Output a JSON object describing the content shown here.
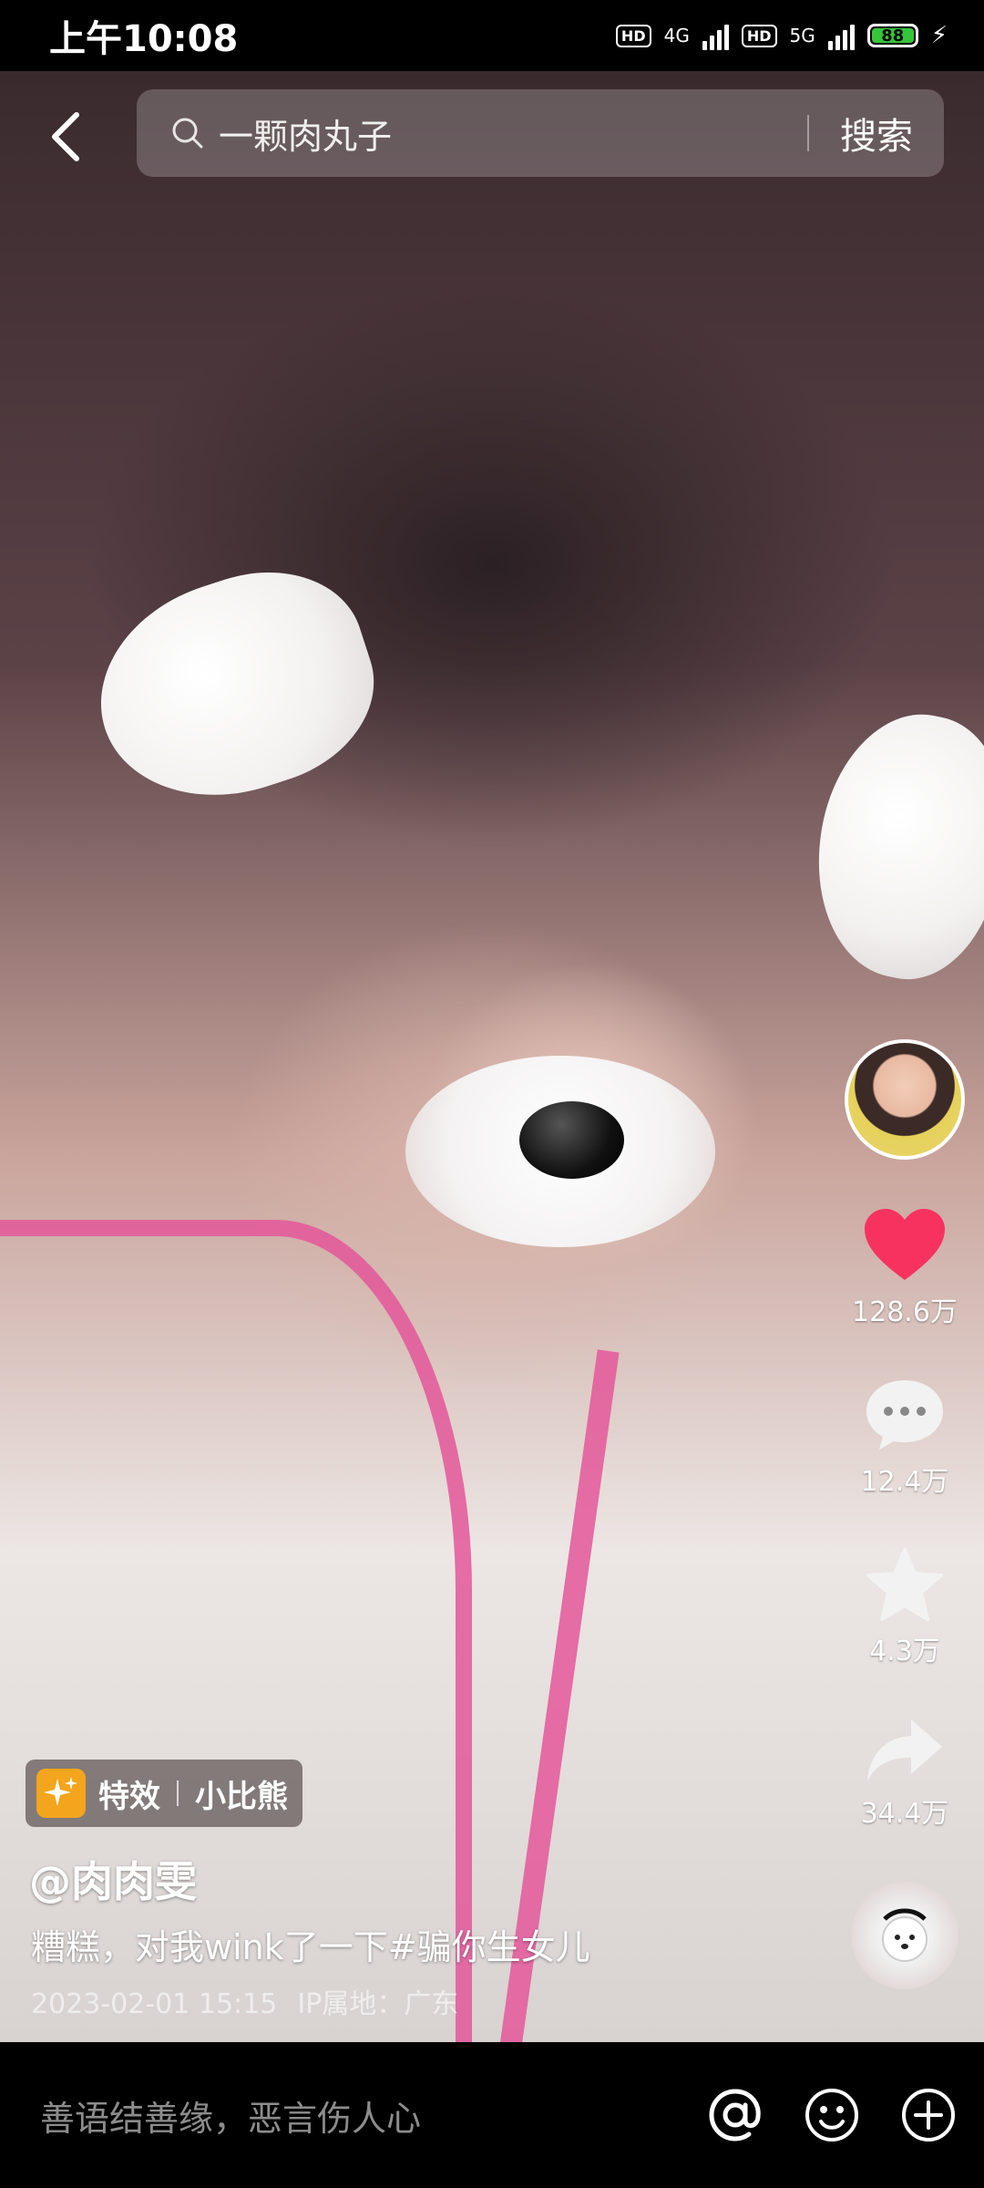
{
  "status_bar": {
    "time": "上午10:08",
    "net1": "4G",
    "net2": "5G",
    "battery": "88"
  },
  "search": {
    "query": "一颗肉丸子",
    "button_label": "搜索"
  },
  "actions": {
    "likes": "128.6万",
    "comments": "12.4万",
    "favorites": "4.3万",
    "shares": "34.4万"
  },
  "effect": {
    "label": "特效",
    "name": "小比熊"
  },
  "post": {
    "author": "@肉肉雯",
    "caption": "糟糕，对我wink了一下#骗你生女儿",
    "date": "2023-02-01 15:15",
    "location": "IP属地：广东"
  },
  "comment_bar": {
    "placeholder": "善语结善缘，恶言伤人心"
  },
  "colors": {
    "like": "#f7325e",
    "effect_badge": "#f3a51d"
  }
}
